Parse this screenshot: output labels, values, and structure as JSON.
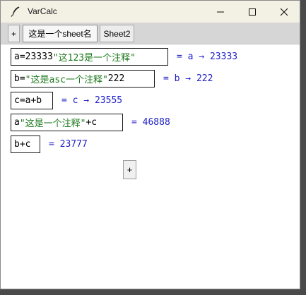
{
  "window": {
    "title": "VarCalc",
    "controls": [
      "minimize",
      "maximize",
      "close"
    ]
  },
  "tabs": [
    {
      "label": "+"
    },
    {
      "label": "这是一个sheet名"
    },
    {
      "label": "Sheet2"
    }
  ],
  "rows": [
    {
      "parts": [
        {
          "text": "a=23333",
          "kind": "code"
        },
        {
          "text": "\"这123是一个注释\"",
          "kind": "string"
        }
      ],
      "result": "= a → 23333"
    },
    {
      "parts": [
        {
          "text": "b=",
          "kind": "code"
        },
        {
          "text": "\"这是asc一个注释\"",
          "kind": "string"
        },
        {
          "text": "222",
          "kind": "code"
        }
      ],
      "result": "= b → 222"
    },
    {
      "parts": [
        {
          "text": "c=a+b",
          "kind": "code"
        }
      ],
      "result": "= c → 23555"
    },
    {
      "parts": [
        {
          "text": "a",
          "kind": "code"
        },
        {
          "text": "\"这是一个注释\"",
          "kind": "string"
        },
        {
          "text": "+c",
          "kind": "code"
        }
      ],
      "result": "= 46888"
    },
    {
      "parts": [
        {
          "text": "b+c",
          "kind": "code"
        }
      ],
      "result": "= 23777"
    }
  ],
  "add_row_button": {
    "label": "+"
  },
  "colors": {
    "string": "#1f7a1f",
    "result": "#2020c8",
    "code": "#000000"
  }
}
